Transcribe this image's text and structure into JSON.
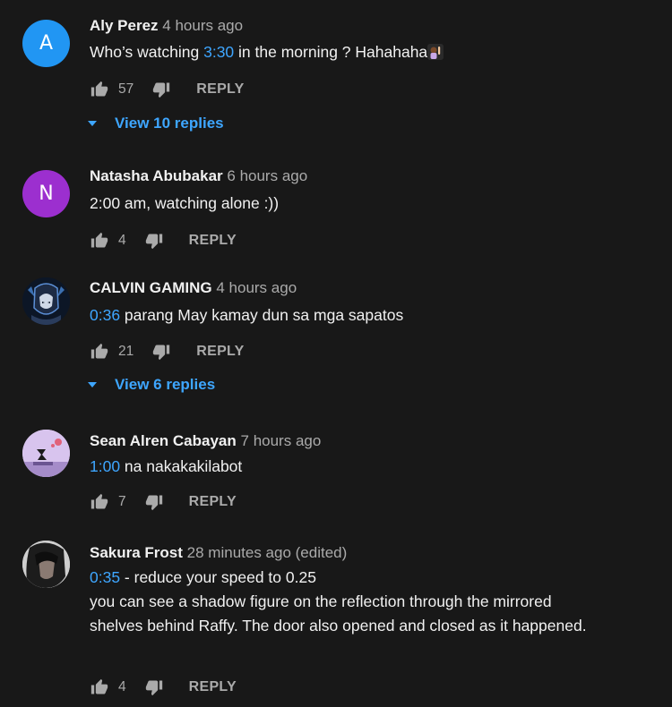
{
  "comments": [
    {
      "avatar_letter": "A",
      "avatar_color": "#2196f3",
      "author": "Aly Perez",
      "time": "4 hours ago",
      "timestamp": "3:30",
      "text_after": " in the morning ? Hahahaha",
      "emoji": "person-raising-hand-emoji",
      "likes": "57",
      "reply_label": "REPLY",
      "view_replies": "View 10 replies"
    },
    {
      "avatar_letter": "N",
      "avatar_color": "#9c2fcf",
      "author": "Natasha Abubakar",
      "time": "6 hours ago",
      "text": "2:00 am, watching alone :))",
      "likes": "4",
      "reply_label": "REPLY"
    },
    {
      "avatar_image": "calvin-gaming-avatar",
      "author": "CALVIN GAMING",
      "time": "4 hours ago",
      "timestamp": "0:36",
      "text_after": " parang May kamay dun sa mga sapatos",
      "likes": "21",
      "reply_label": "REPLY",
      "view_replies": "View 6 replies"
    },
    {
      "avatar_image": "sean-alren-avatar",
      "author": "Sean Alren Cabayan",
      "time": "7 hours ago",
      "timestamp": "1:00",
      "text_after": " na nakakakilabot",
      "likes": "7",
      "reply_label": "REPLY"
    },
    {
      "avatar_image": "sakura-frost-avatar",
      "author": "Sakura Frost",
      "time": "28 minutes ago (edited)",
      "timestamp": "0:35",
      "text_after": " - reduce your speed to 0.25",
      "text_rest": "you can see a shadow figure on the reflection through the mirrored shelves behind Raffy.  The door also opened and closed as it happened.",
      "likes": "4",
      "reply_label": "REPLY"
    }
  ],
  "colors": {
    "background": "#181818",
    "text": "#f1f1f1",
    "secondary": "#aaaaaa",
    "link": "#3ea6ff"
  }
}
